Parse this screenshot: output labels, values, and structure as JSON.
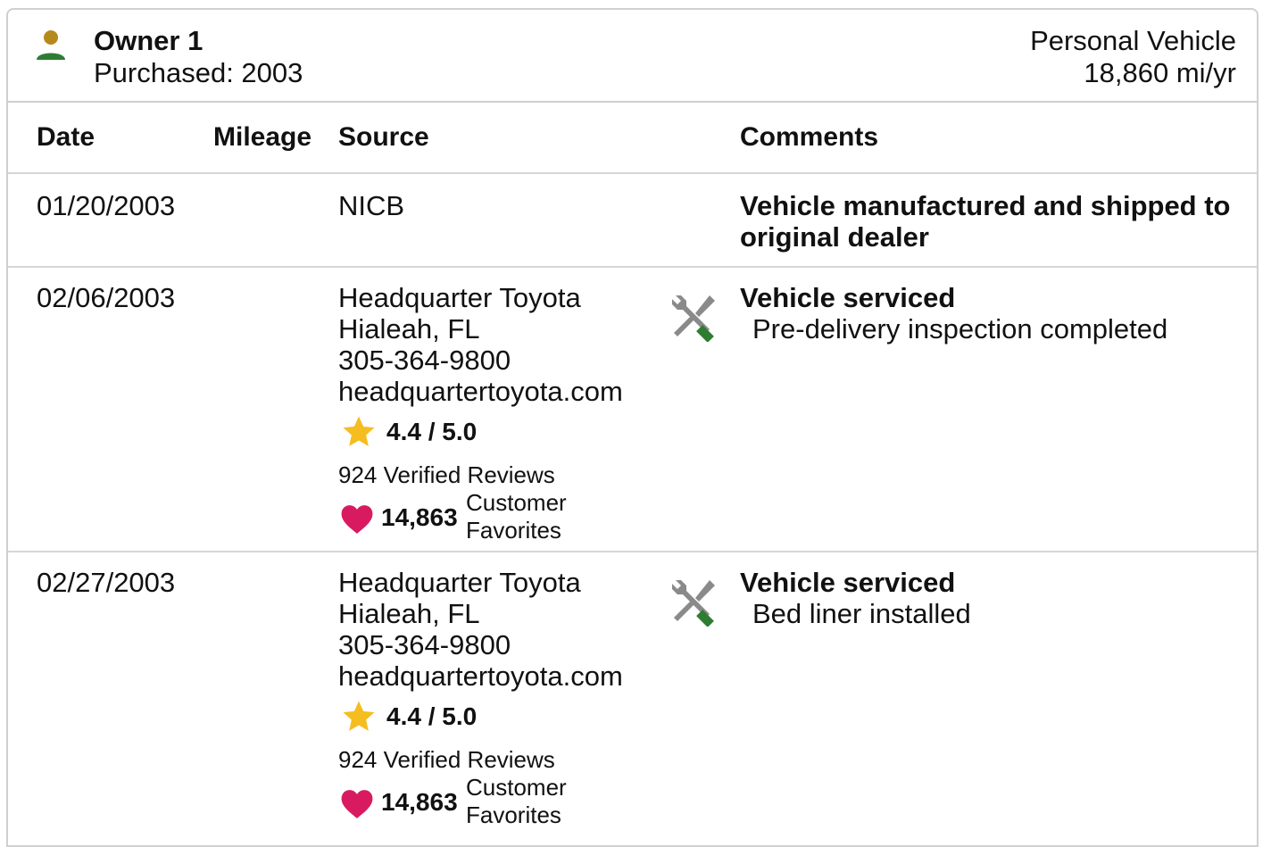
{
  "owner": {
    "title": "Owner 1",
    "purchased": "Purchased: 2003",
    "usage_type": "Personal Vehicle",
    "annual_mileage": "18,860 mi/yr",
    "icon": "person-icon",
    "icon_colors": {
      "head": "#b5891c",
      "body": "#2e7d32"
    }
  },
  "table": {
    "columns": [
      "Date",
      "Mileage",
      "Source",
      "Comments"
    ],
    "rows": [
      {
        "date": "01/20/2003",
        "mileage": "",
        "source": {
          "name": "NICB"
        },
        "comment_title": "Vehicle manufactured and shipped to original dealer"
      },
      {
        "date": "02/06/2003",
        "mileage": "",
        "source": {
          "name": "Headquarter Toyota",
          "location": "Hialeah, FL",
          "phone": "305-364-9800",
          "website": "headquartertoyota.com",
          "rating": "4.4 / 5.0",
          "reviews": "924 Verified Reviews",
          "favorites_count": "14,863",
          "favorites_label": "Customer Favorites"
        },
        "icon": "wrench-screwdriver-icon",
        "comment_title": "Vehicle serviced",
        "comment_detail": "Pre-delivery inspection completed"
      },
      {
        "date": "02/27/2003",
        "mileage": "",
        "source": {
          "name": "Headquarter Toyota",
          "location": "Hialeah, FL",
          "phone": "305-364-9800",
          "website": "headquartertoyota.com",
          "rating": "4.4 / 5.0",
          "reviews": "924 Verified Reviews",
          "favorites_count": "14,863",
          "favorites_label": "Customer Favorites"
        },
        "icon": "wrench-screwdriver-icon",
        "comment_title": "Vehicle serviced",
        "comment_detail": "Bed liner installed"
      }
    ]
  },
  "colors": {
    "star": "#f5bd1f",
    "heart": "#d81b60",
    "tool_gray": "#8a8a8a",
    "tool_green": "#2e7d32",
    "divider": "#d6d6d6"
  }
}
